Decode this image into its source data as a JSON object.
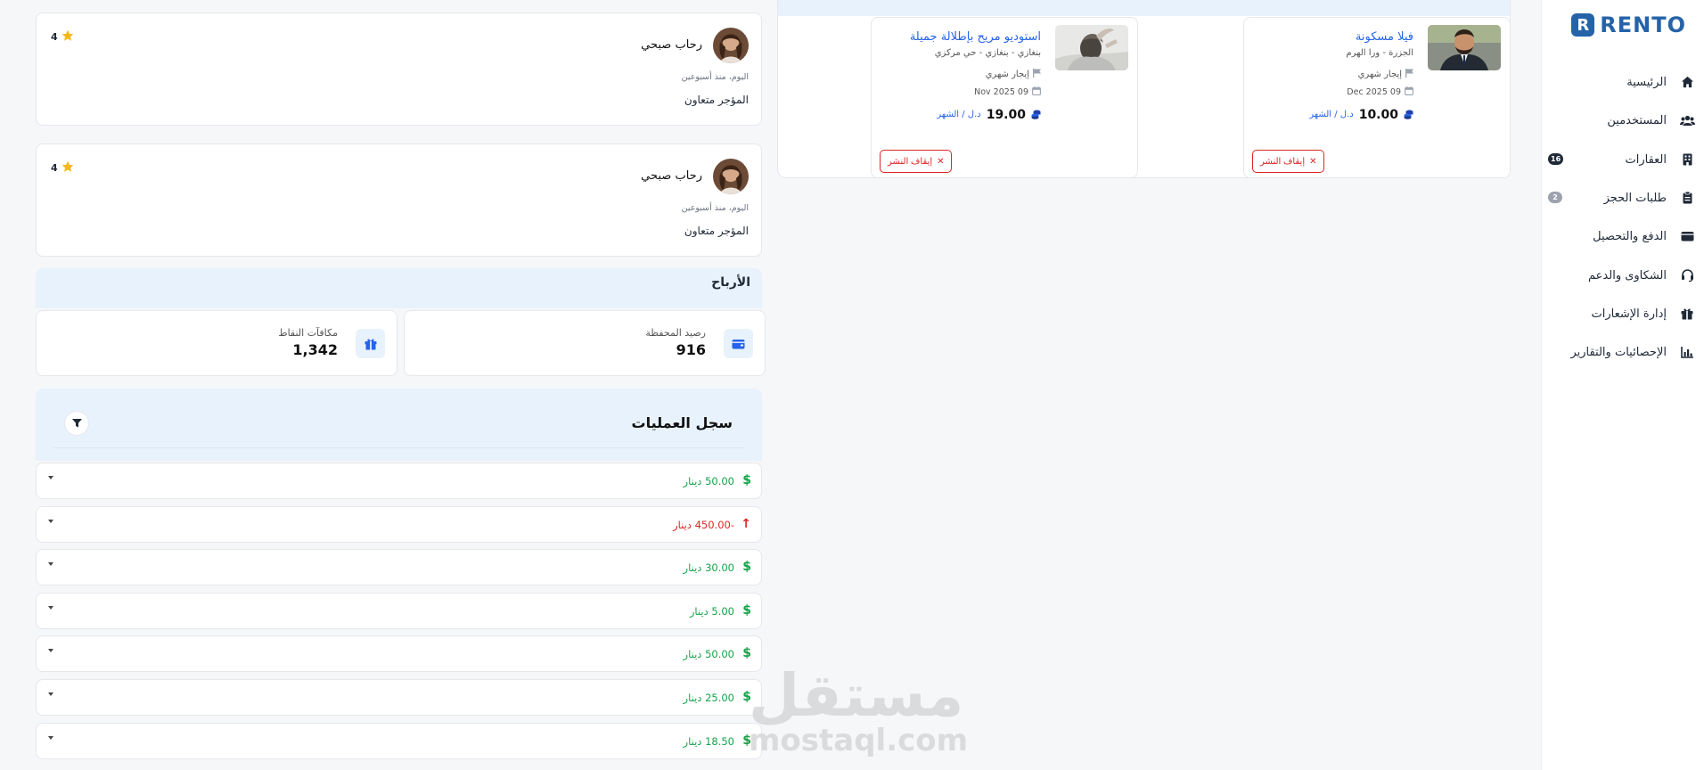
{
  "sidebar": {
    "brand": "RENTO",
    "brand_mark": "R",
    "items": [
      {
        "label": "الرئيسية",
        "icon": "home-icon"
      },
      {
        "label": "المستخدمين",
        "icon": "users-icon"
      },
      {
        "label": "العقارات",
        "icon": "building-icon",
        "badge": "16"
      },
      {
        "label": "طلبات الحجز",
        "icon": "clipboard-icon",
        "badge": "2"
      },
      {
        "label": "الدفع والتحصيل",
        "icon": "wallet-icon"
      },
      {
        "label": "الشكاوى والدعم",
        "icon": "headset-icon"
      },
      {
        "label": "إدارة الإشعارات",
        "icon": "gift-icon"
      },
      {
        "label": "الإحصائيات والتقارير",
        "icon": "chart-icon"
      }
    ]
  },
  "listings": [
    {
      "title": "فيلا مسكونة",
      "location": "الجزرة - ورا الهرم",
      "rent_type": "إيجار شهري",
      "date": "09 Dec 2025",
      "price": "10.00",
      "unit": "د.ل / الشهر",
      "unpublish_label": "إيقاف النشر"
    },
    {
      "title": "استوديو مريح بإطلالة جميلة",
      "location": "بنغازي - بنغازي - حي مركزي",
      "rent_type": "إيجار شهري",
      "date": "09 Nov 2025",
      "price": "19.00",
      "unit": "د.ل / الشهر",
      "unpublish_label": "إيقاف النشر"
    }
  ],
  "reviews": [
    {
      "name": "رحاب صبحي",
      "time": "اليوم، منذ أسبوعين",
      "text": "المؤجر متعاون",
      "rating": "4"
    },
    {
      "name": "رحاب صبحي",
      "time": "اليوم، منذ أسبوعين",
      "text": "المؤجر متعاون",
      "rating": "4"
    }
  ],
  "earnings": {
    "title": "الأرباح",
    "wallet_label": "رصيد المحفظة",
    "wallet_value": "916",
    "points_label": "مكافآت النقاط",
    "points_value": "1,342"
  },
  "operations": {
    "title": "سجل العمليات",
    "rows": [
      {
        "amount": "50.00 دينار",
        "direction": "in"
      },
      {
        "amount": "-450.00 دينار",
        "direction": "out"
      },
      {
        "amount": "30.00 دينار",
        "direction": "in"
      },
      {
        "amount": "5.00 دينار",
        "direction": "in"
      },
      {
        "amount": "50.00 دينار",
        "direction": "in"
      },
      {
        "amount": "25.00 دينار",
        "direction": "in"
      },
      {
        "amount": "18.50 دينار",
        "direction": "in"
      }
    ]
  },
  "watermark": {
    "arabic": "مستقل",
    "latin": "mostaql.com"
  },
  "colors": {
    "accent": "#2563eb",
    "positive": "#16a34a",
    "negative": "#dc2626",
    "header_tint": "#e8f2fd",
    "brand": "#2563a8"
  }
}
